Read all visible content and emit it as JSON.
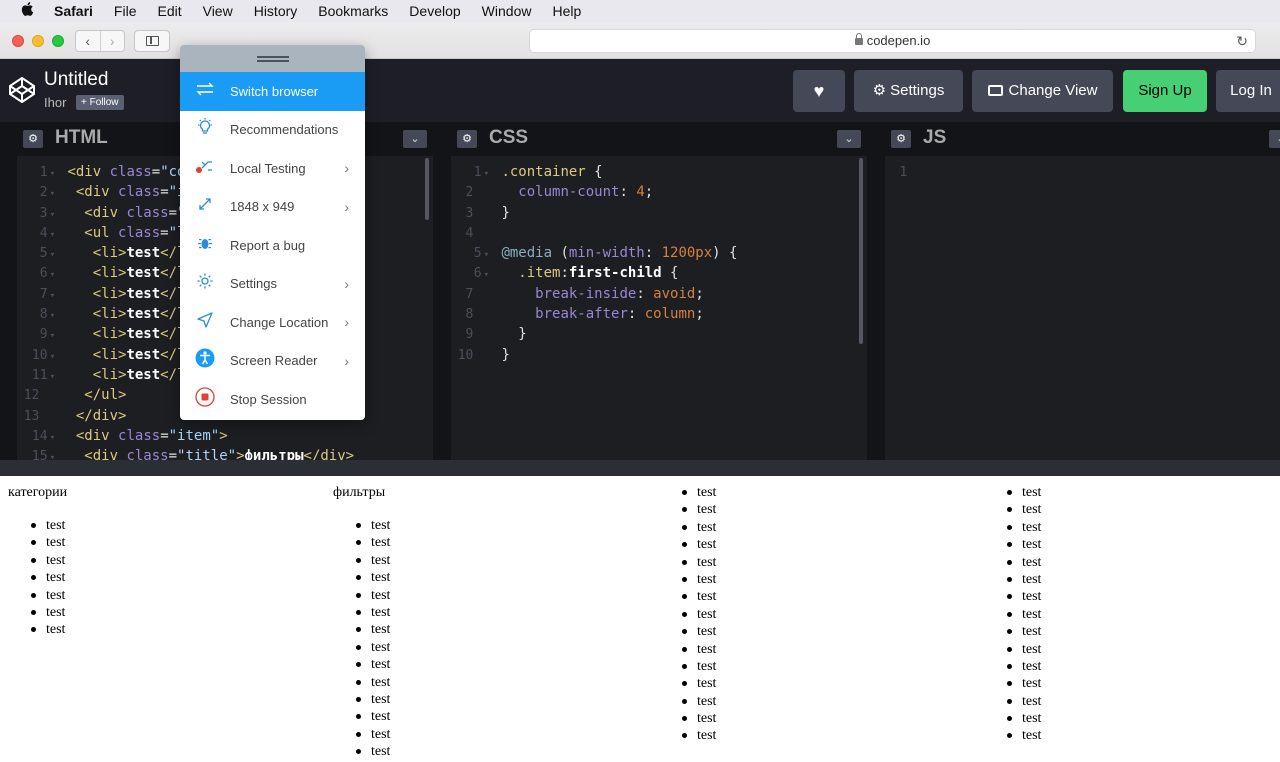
{
  "menubar": {
    "app": "Safari",
    "items": [
      "File",
      "Edit",
      "View",
      "History",
      "Bookmarks",
      "Develop",
      "Window",
      "Help"
    ]
  },
  "browser": {
    "url": "codepen.io"
  },
  "header": {
    "title": "Untitled",
    "user": "Ihor",
    "follow_label": "+ Follow",
    "settings_label": "Settings",
    "change_view_label": "Change View",
    "signup_label": "Sign Up",
    "login_label": "Log In"
  },
  "editors": {
    "html_title": "HTML",
    "css_title": "CSS",
    "js_title": "JS",
    "html_lines": [
      {
        "n": "1",
        "fold": true,
        "segs": [
          [
            "tag",
            "<div "
          ],
          [
            "attr",
            "class"
          ],
          [
            "pun",
            "="
          ],
          [
            "str",
            "\"con"
          ]
        ]
      },
      {
        "n": "2",
        "fold": true,
        "segs": [
          [
            "pun",
            " "
          ],
          [
            "tag",
            "<div "
          ],
          [
            "attr",
            "class"
          ],
          [
            "pun",
            "="
          ],
          [
            "str",
            "\"it"
          ]
        ]
      },
      {
        "n": "3",
        "fold": true,
        "segs": [
          [
            "pun",
            "  "
          ],
          [
            "tag",
            "<div "
          ],
          [
            "attr",
            "class"
          ],
          [
            "pun",
            "="
          ],
          [
            "str",
            "\"t"
          ]
        ]
      },
      {
        "n": "4",
        "fold": true,
        "segs": [
          [
            "pun",
            "  "
          ],
          [
            "tag",
            "<ul "
          ],
          [
            "attr",
            "class"
          ],
          [
            "pun",
            "="
          ],
          [
            "str",
            "\"li"
          ]
        ]
      },
      {
        "n": "5",
        "fold": true,
        "segs": [
          [
            "pun",
            "   "
          ],
          [
            "tag",
            "<li>"
          ],
          [
            "txt",
            "test"
          ],
          [
            "tag",
            "</li"
          ]
        ]
      },
      {
        "n": "6",
        "fold": true,
        "segs": [
          [
            "pun",
            "   "
          ],
          [
            "tag",
            "<li>"
          ],
          [
            "txt",
            "test"
          ],
          [
            "tag",
            "</li"
          ]
        ]
      },
      {
        "n": "7",
        "fold": true,
        "segs": [
          [
            "pun",
            "   "
          ],
          [
            "tag",
            "<li>"
          ],
          [
            "txt",
            "test"
          ],
          [
            "tag",
            "</li"
          ]
        ]
      },
      {
        "n": "8",
        "fold": true,
        "segs": [
          [
            "pun",
            "   "
          ],
          [
            "tag",
            "<li>"
          ],
          [
            "txt",
            "test"
          ],
          [
            "tag",
            "</li"
          ]
        ]
      },
      {
        "n": "9",
        "fold": true,
        "segs": [
          [
            "pun",
            "   "
          ],
          [
            "tag",
            "<li>"
          ],
          [
            "txt",
            "test"
          ],
          [
            "tag",
            "</li"
          ]
        ]
      },
      {
        "n": "10",
        "fold": true,
        "segs": [
          [
            "pun",
            "   "
          ],
          [
            "tag",
            "<li>"
          ],
          [
            "txt",
            "test"
          ],
          [
            "tag",
            "</li"
          ]
        ]
      },
      {
        "n": "11",
        "fold": true,
        "segs": [
          [
            "pun",
            "   "
          ],
          [
            "tag",
            "<li>"
          ],
          [
            "txt",
            "test"
          ],
          [
            "tag",
            "</li"
          ]
        ]
      },
      {
        "n": "12",
        "fold": false,
        "segs": [
          [
            "pun",
            "  "
          ],
          [
            "tag",
            "</ul>"
          ]
        ]
      },
      {
        "n": "13",
        "fold": false,
        "segs": [
          [
            "pun",
            " "
          ],
          [
            "tag",
            "</div>"
          ]
        ]
      },
      {
        "n": "14",
        "fold": true,
        "segs": [
          [
            "pun",
            " "
          ],
          [
            "tag",
            "<div "
          ],
          [
            "attr",
            "class"
          ],
          [
            "pun",
            "="
          ],
          [
            "str",
            "\"item\""
          ],
          [
            "tag",
            ">"
          ]
        ]
      },
      {
        "n": "15",
        "fold": true,
        "segs": [
          [
            "pun",
            "  "
          ],
          [
            "tag",
            "<div "
          ],
          [
            "attr",
            "class"
          ],
          [
            "pun",
            "="
          ],
          [
            "str",
            "\"title\""
          ],
          [
            "tag",
            ">"
          ],
          [
            "txt",
            "фильтры"
          ],
          [
            "tag",
            "</div>"
          ]
        ]
      }
    ],
    "css_lines": [
      {
        "n": "1",
        "fold": true,
        "segs": [
          [
            "sel",
            ".container"
          ],
          [
            "pun",
            " {"
          ]
        ]
      },
      {
        "n": "2",
        "fold": false,
        "segs": [
          [
            "pun",
            "  "
          ],
          [
            "prop",
            "column-count"
          ],
          [
            "pun",
            ": "
          ],
          [
            "num",
            "4"
          ],
          [
            "pun",
            ";"
          ]
        ]
      },
      {
        "n": "3",
        "fold": false,
        "segs": [
          [
            "pun",
            "}"
          ]
        ]
      },
      {
        "n": "4",
        "fold": false,
        "segs": []
      },
      {
        "n": "5",
        "fold": true,
        "segs": [
          [
            "kw",
            "@media"
          ],
          [
            "pun",
            " ("
          ],
          [
            "prop",
            "min-width"
          ],
          [
            "pun",
            ": "
          ],
          [
            "num",
            "1200px"
          ],
          [
            "pun",
            ") {"
          ]
        ]
      },
      {
        "n": "6",
        "fold": true,
        "segs": [
          [
            "pun",
            "  "
          ],
          [
            "sel",
            ".item"
          ],
          [
            "pun",
            ":"
          ],
          [
            "txt",
            "first-child"
          ],
          [
            "pun",
            " {"
          ]
        ]
      },
      {
        "n": "7",
        "fold": false,
        "segs": [
          [
            "pun",
            "    "
          ],
          [
            "prop",
            "break-inside"
          ],
          [
            "pun",
            ": "
          ],
          [
            "num",
            "avoid"
          ],
          [
            "pun",
            ";"
          ]
        ]
      },
      {
        "n": "8",
        "fold": false,
        "segs": [
          [
            "pun",
            "    "
          ],
          [
            "prop",
            "break-after"
          ],
          [
            "pun",
            ": "
          ],
          [
            "num",
            "column"
          ],
          [
            "pun",
            ";"
          ]
        ]
      },
      {
        "n": "9",
        "fold": false,
        "segs": [
          [
            "pun",
            "  }"
          ]
        ]
      },
      {
        "n": "10",
        "fold": false,
        "segs": [
          [
            "pun",
            "}"
          ]
        ]
      }
    ],
    "js_lines": [
      {
        "n": "1",
        "fold": false,
        "segs": []
      }
    ]
  },
  "result": {
    "columns": [
      {
        "title": "категории",
        "items": [
          "test",
          "test",
          "test",
          "test",
          "test",
          "test",
          "test"
        ]
      },
      {
        "title": "фильтры",
        "items": [
          "test",
          "test",
          "test",
          "test",
          "test",
          "test",
          "test",
          "test",
          "test",
          "test",
          "test",
          "test",
          "test",
          "test"
        ]
      },
      {
        "title": "",
        "items": [
          "test",
          "test",
          "test",
          "test",
          "test",
          "test",
          "test",
          "test",
          "test",
          "test",
          "test",
          "test",
          "test",
          "test",
          "test"
        ]
      },
      {
        "title": "",
        "items": [
          "test",
          "test",
          "test",
          "test",
          "test",
          "test",
          "test",
          "test",
          "test",
          "test",
          "test",
          "test",
          "test",
          "test",
          "test"
        ]
      }
    ]
  },
  "menu": {
    "items": [
      {
        "label": "Switch browser",
        "icon": "switch-icon",
        "chevron": false,
        "active": true
      },
      {
        "label": "Recommendations",
        "icon": "lightbulb-icon",
        "chevron": false,
        "active": false
      },
      {
        "label": "Local Testing",
        "icon": "local-testing-icon",
        "chevron": true,
        "active": false
      },
      {
        "label": "1848 x 949",
        "icon": "resolution-icon",
        "chevron": true,
        "active": false
      },
      {
        "label": "Report a bug",
        "icon": "bug-icon",
        "chevron": false,
        "active": false
      },
      {
        "label": "Settings",
        "icon": "gear-icon",
        "chevron": true,
        "active": false
      },
      {
        "label": "Change Location",
        "icon": "location-arrow-icon",
        "chevron": true,
        "active": false
      },
      {
        "label": "Screen Reader",
        "icon": "accessibility-icon",
        "chevron": true,
        "active": false
      },
      {
        "label": "Stop Session",
        "icon": "stop-icon",
        "chevron": false,
        "active": false
      }
    ]
  }
}
